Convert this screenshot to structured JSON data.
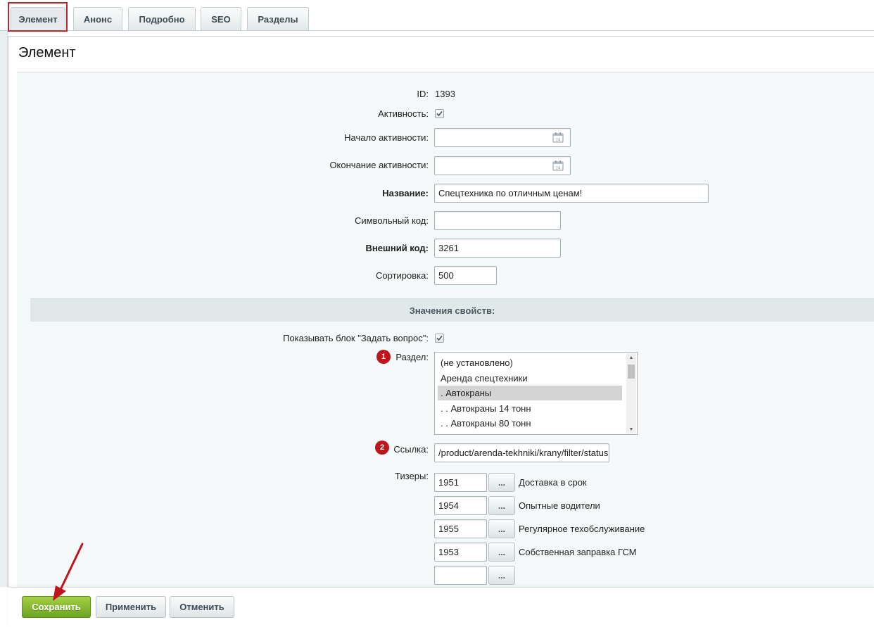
{
  "tabs": [
    {
      "label": "Элемент",
      "active": true
    },
    {
      "label": "Анонс",
      "active": false
    },
    {
      "label": "Подробно",
      "active": false
    },
    {
      "label": "SEO",
      "active": false
    },
    {
      "label": "Разделы",
      "active": false
    }
  ],
  "panel": {
    "title": "Элемент"
  },
  "fields": {
    "id": {
      "label": "ID:",
      "value": "1393"
    },
    "active": {
      "label": "Активность:",
      "checked": true
    },
    "active_from": {
      "label": "Начало активности:",
      "value": "",
      "icon": "calendar-icon"
    },
    "active_to": {
      "label": "Окончание активности:",
      "value": "",
      "icon": "calendar-icon"
    },
    "name": {
      "label": "Название:",
      "value": "Спецтехника по отличным ценам!"
    },
    "code": {
      "label": "Символьный код:",
      "value": ""
    },
    "xml_id": {
      "label": "Внешний код:",
      "value": "3261"
    },
    "sort": {
      "label": "Сортировка:",
      "value": "500"
    }
  },
  "properties": {
    "header": "Значения свойств:",
    "show_question": {
      "label": "Показывать блок \"Задать вопрос\":",
      "checked": true
    },
    "section": {
      "label": "Раздел:",
      "badge": "1",
      "options": [
        {
          "label": "(не установлено)",
          "selected": false
        },
        {
          "label": "Аренда спецтехники",
          "selected": false
        },
        {
          "label": ". Автокраны",
          "selected": true
        },
        {
          "label": ". . Автокраны 14 тонн",
          "selected": false
        },
        {
          "label": ". . Автокраны 80 тонн",
          "selected": false
        }
      ]
    },
    "link": {
      "label": "Ссылка:",
      "badge": "2",
      "value": "/product/arenda-tekhniki/krany/filter/status"
    },
    "teasers": {
      "label": "Тизеры:",
      "button_label": "...",
      "items": [
        {
          "id": "1951",
          "name": "Доставка в срок"
        },
        {
          "id": "1954",
          "name": "Опытные водители"
        },
        {
          "id": "1955",
          "name": "Регулярное техобслуживание"
        },
        {
          "id": "1953",
          "name": "Собственная заправка ГСМ"
        },
        {
          "id": "",
          "name": ""
        }
      ]
    }
  },
  "footer": {
    "save_label": "Сохранить",
    "apply_label": "Применить",
    "cancel_label": "Отменить"
  },
  "colors": {
    "highlight": "#c0262d",
    "badge": "#c0141c",
    "save_button": "#7cb32b",
    "arrow": "#c0141c"
  }
}
